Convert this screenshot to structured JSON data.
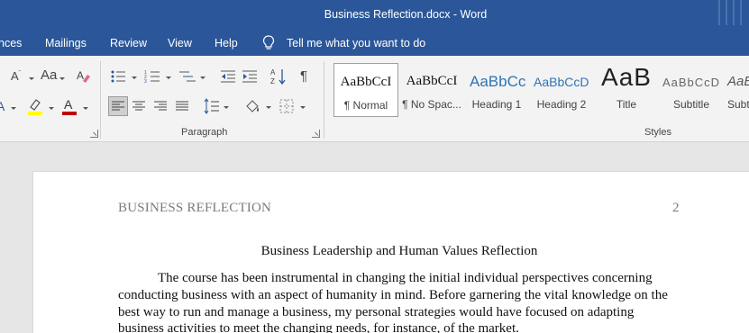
{
  "window": {
    "title": "Business Reflection.docx  -  Word"
  },
  "tabs": [
    "nces",
    "Mailings",
    "Review",
    "View",
    "Help"
  ],
  "tell_me": "Tell me what you want to do",
  "groups": {
    "paragraph": "Paragraph",
    "styles": "Styles"
  },
  "styles_gallery": [
    {
      "sample": "AaBbCcI",
      "label": "¶ Normal"
    },
    {
      "sample": "AaBbCcI",
      "label": "¶ No Spac..."
    },
    {
      "sample": "AaBbCc",
      "label": "Heading 1"
    },
    {
      "sample": "AaBbCcD",
      "label": "Heading 2"
    },
    {
      "sample": "AaB",
      "label": "Title"
    },
    {
      "sample": "AaBbCcD",
      "label": "Subtitle"
    },
    {
      "sample": "AaB",
      "label": "Subt"
    }
  ],
  "colors": {
    "word_blue": "#2b579a",
    "highlight": "#ffff00",
    "font_color": "#c00000"
  },
  "document": {
    "header_left": "BUSINESS REFLECTION",
    "page_number": "2",
    "title": "Business Leadership and Human Values Reflection",
    "body": "The course has been instrumental in changing the initial individual perspectives concerning conducting business with an aspect of humanity in mind. Before garnering the vital knowledge on the best way to run and manage a business, my personal strategies would have focused on adapting business activities to meet the changing needs, for instance, of the market."
  }
}
